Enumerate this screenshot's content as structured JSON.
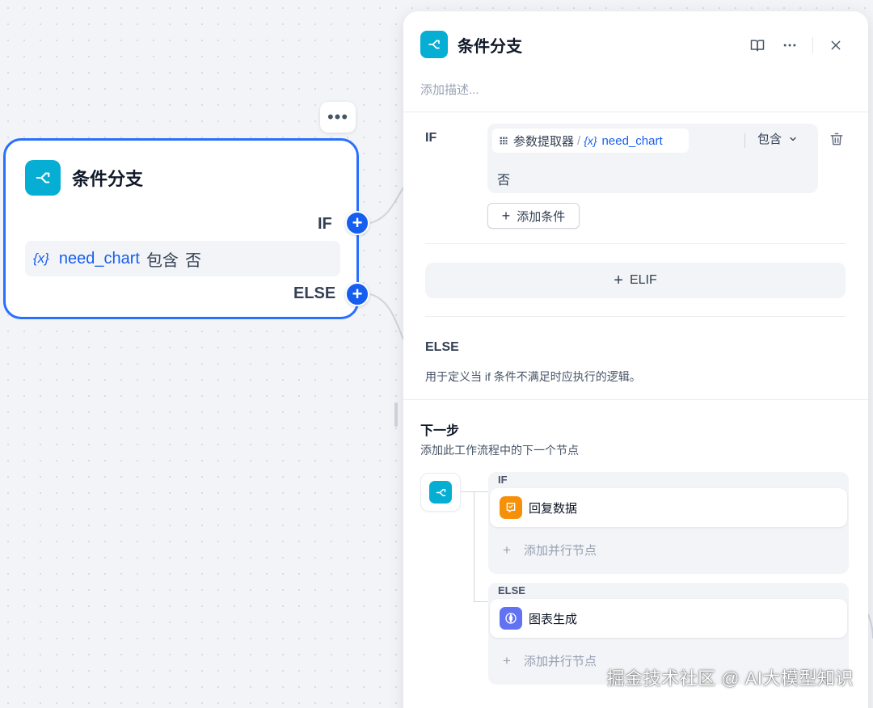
{
  "canvas_node": {
    "title": "条件分支",
    "if_label": "IF",
    "else_label": "ELSE",
    "more_label": "•••",
    "port_plus": "+",
    "condition": {
      "var_glyph": "{x}",
      "variable": "need_chart",
      "operator": "包含",
      "value": "否"
    }
  },
  "panel": {
    "title": "条件分支",
    "description_placeholder": "添加描述...",
    "actions": [
      "book-icon",
      "more-icon",
      "close-icon"
    ],
    "if_section": {
      "label": "IF",
      "source_node": "参数提取器",
      "separator": "/",
      "var_glyph": "{x}",
      "variable": "need_chart",
      "operator": "包含",
      "value": "否",
      "add_condition": "添加条件"
    },
    "elif_button": "ELIF",
    "else_section": {
      "title": "ELSE",
      "description": "用于定义当 if 条件不满足时应执行的逻辑。"
    },
    "next_step": {
      "title": "下一步",
      "description": "添加此工作流程中的下一个节点",
      "branches": [
        {
          "label": "IF",
          "target": "回复数据",
          "target_icon": "reply-icon",
          "color": "#f79009",
          "add_parallel": "添加并行节点"
        },
        {
          "label": "ELSE",
          "target": "图表生成",
          "target_icon": "compass-icon",
          "color": "#6172f3",
          "add_parallel": "添加并行节点"
        }
      ]
    }
  },
  "watermark": "掘金技术社区 @ AI大模型知识",
  "colors": {
    "accent": "#155eef",
    "node_border": "#2970ff",
    "branch_icon_bg": "#06aed4"
  }
}
